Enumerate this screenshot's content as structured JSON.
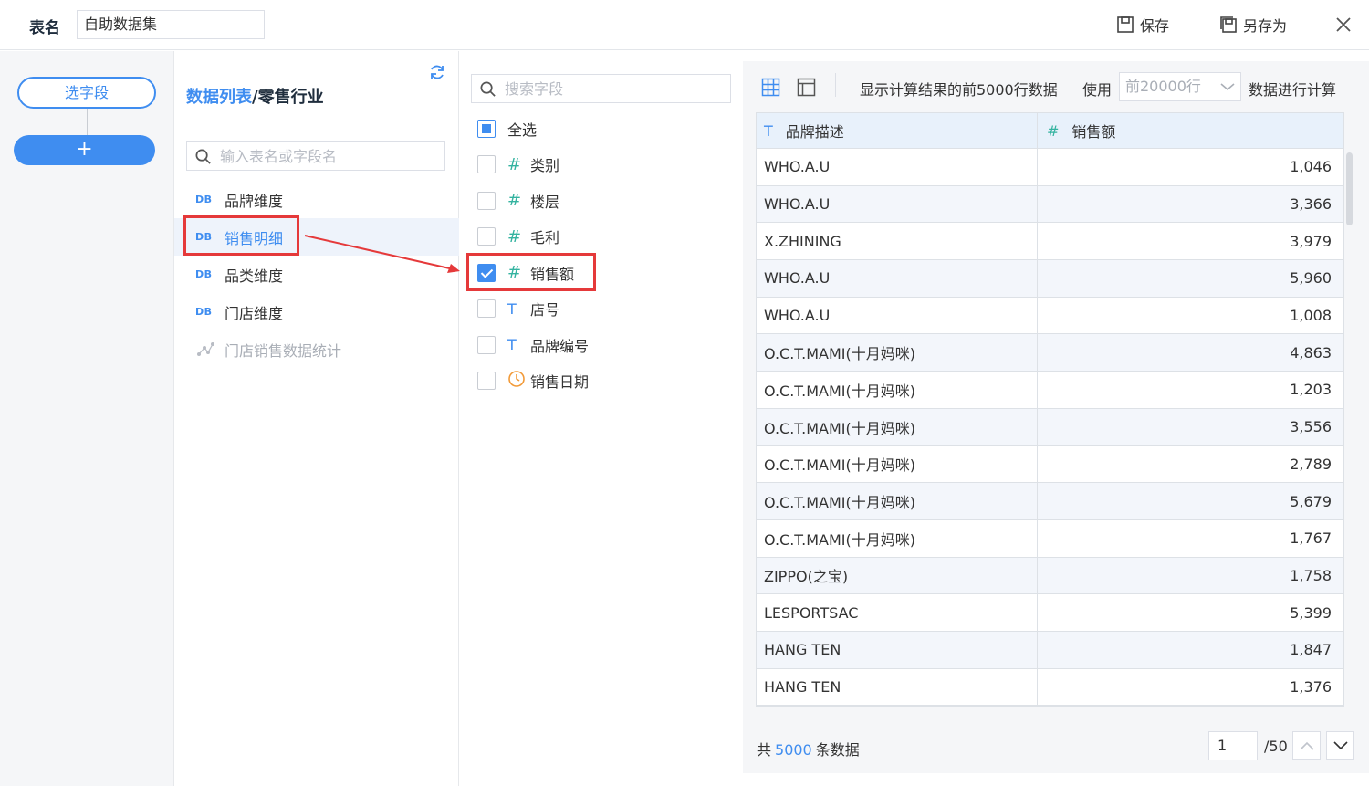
{
  "header": {
    "table_name_label": "表名",
    "table_name_value": "自助数据集",
    "save_label": "保存",
    "save_as_label": "另存为"
  },
  "steps": {
    "select_fields_label": "选字段",
    "add_label": "+"
  },
  "tables_panel": {
    "breadcrumb_root": "数据列表",
    "breadcrumb_sep": "/",
    "breadcrumb_current": "零售行业",
    "search_placeholder": "输入表名或字段名",
    "items": [
      {
        "label": "品牌维度",
        "icon": "DB",
        "state": "normal"
      },
      {
        "label": "销售明细",
        "icon": "DB",
        "state": "active"
      },
      {
        "label": "品类维度",
        "icon": "DB",
        "state": "normal"
      },
      {
        "label": "门店维度",
        "icon": "DB",
        "state": "normal"
      },
      {
        "label": "门店销售数据统计",
        "icon": "network-icon",
        "state": "disabled"
      }
    ]
  },
  "fields_panel": {
    "search_placeholder": "搜索字段",
    "select_all_label": "全选",
    "fields": [
      {
        "label": "类别",
        "type": "#",
        "checked": false
      },
      {
        "label": "楼层",
        "type": "#",
        "checked": false
      },
      {
        "label": "毛利",
        "type": "#",
        "checked": false
      },
      {
        "label": "销售额",
        "type": "#",
        "checked": true
      },
      {
        "label": "店号",
        "type": "T",
        "checked": false
      },
      {
        "label": "品牌编号",
        "type": "T",
        "checked": false
      },
      {
        "label": "销售日期",
        "type": "clock",
        "checked": false
      }
    ]
  },
  "preview": {
    "info_text": "显示计算结果的前5000行数据",
    "use_label": "使用",
    "rows_select_value": "前20000行",
    "calc_suffix": "数据进行计算",
    "columns": [
      {
        "type_icon": "T",
        "label": "品牌描述"
      },
      {
        "type_icon": "#",
        "label": "销售额"
      }
    ],
    "rows": [
      [
        "WHO.A.U",
        "1,046"
      ],
      [
        "WHO.A.U",
        "3,366"
      ],
      [
        "X.ZHINING",
        "3,979"
      ],
      [
        "WHO.A.U",
        "5,960"
      ],
      [
        "WHO.A.U",
        "1,008"
      ],
      [
        "O.C.T.MAMI(十月妈咪)",
        "4,863"
      ],
      [
        "O.C.T.MAMI(十月妈咪)",
        "1,203"
      ],
      [
        "O.C.T.MAMI(十月妈咪)",
        "3,556"
      ],
      [
        "O.C.T.MAMI(十月妈咪)",
        "2,789"
      ],
      [
        "O.C.T.MAMI(十月妈咪)",
        "5,679"
      ],
      [
        "O.C.T.MAMI(十月妈咪)",
        "1,767"
      ],
      [
        "ZIPPO(之宝)",
        "1,758"
      ],
      [
        "LESPORTSAC",
        "5,399"
      ],
      [
        "HANG TEN",
        "1,847"
      ],
      [
        "HANG TEN",
        "1,376"
      ]
    ],
    "footer": {
      "total_prefix": "共",
      "total_count": "5000",
      "total_suffix": "条数据",
      "current_page": "1",
      "total_pages": "/50"
    }
  },
  "colors": {
    "accent": "#3f8df0",
    "highlight": "#e5393a",
    "number_type": "#34b3a0",
    "date_type": "#f29a38"
  }
}
